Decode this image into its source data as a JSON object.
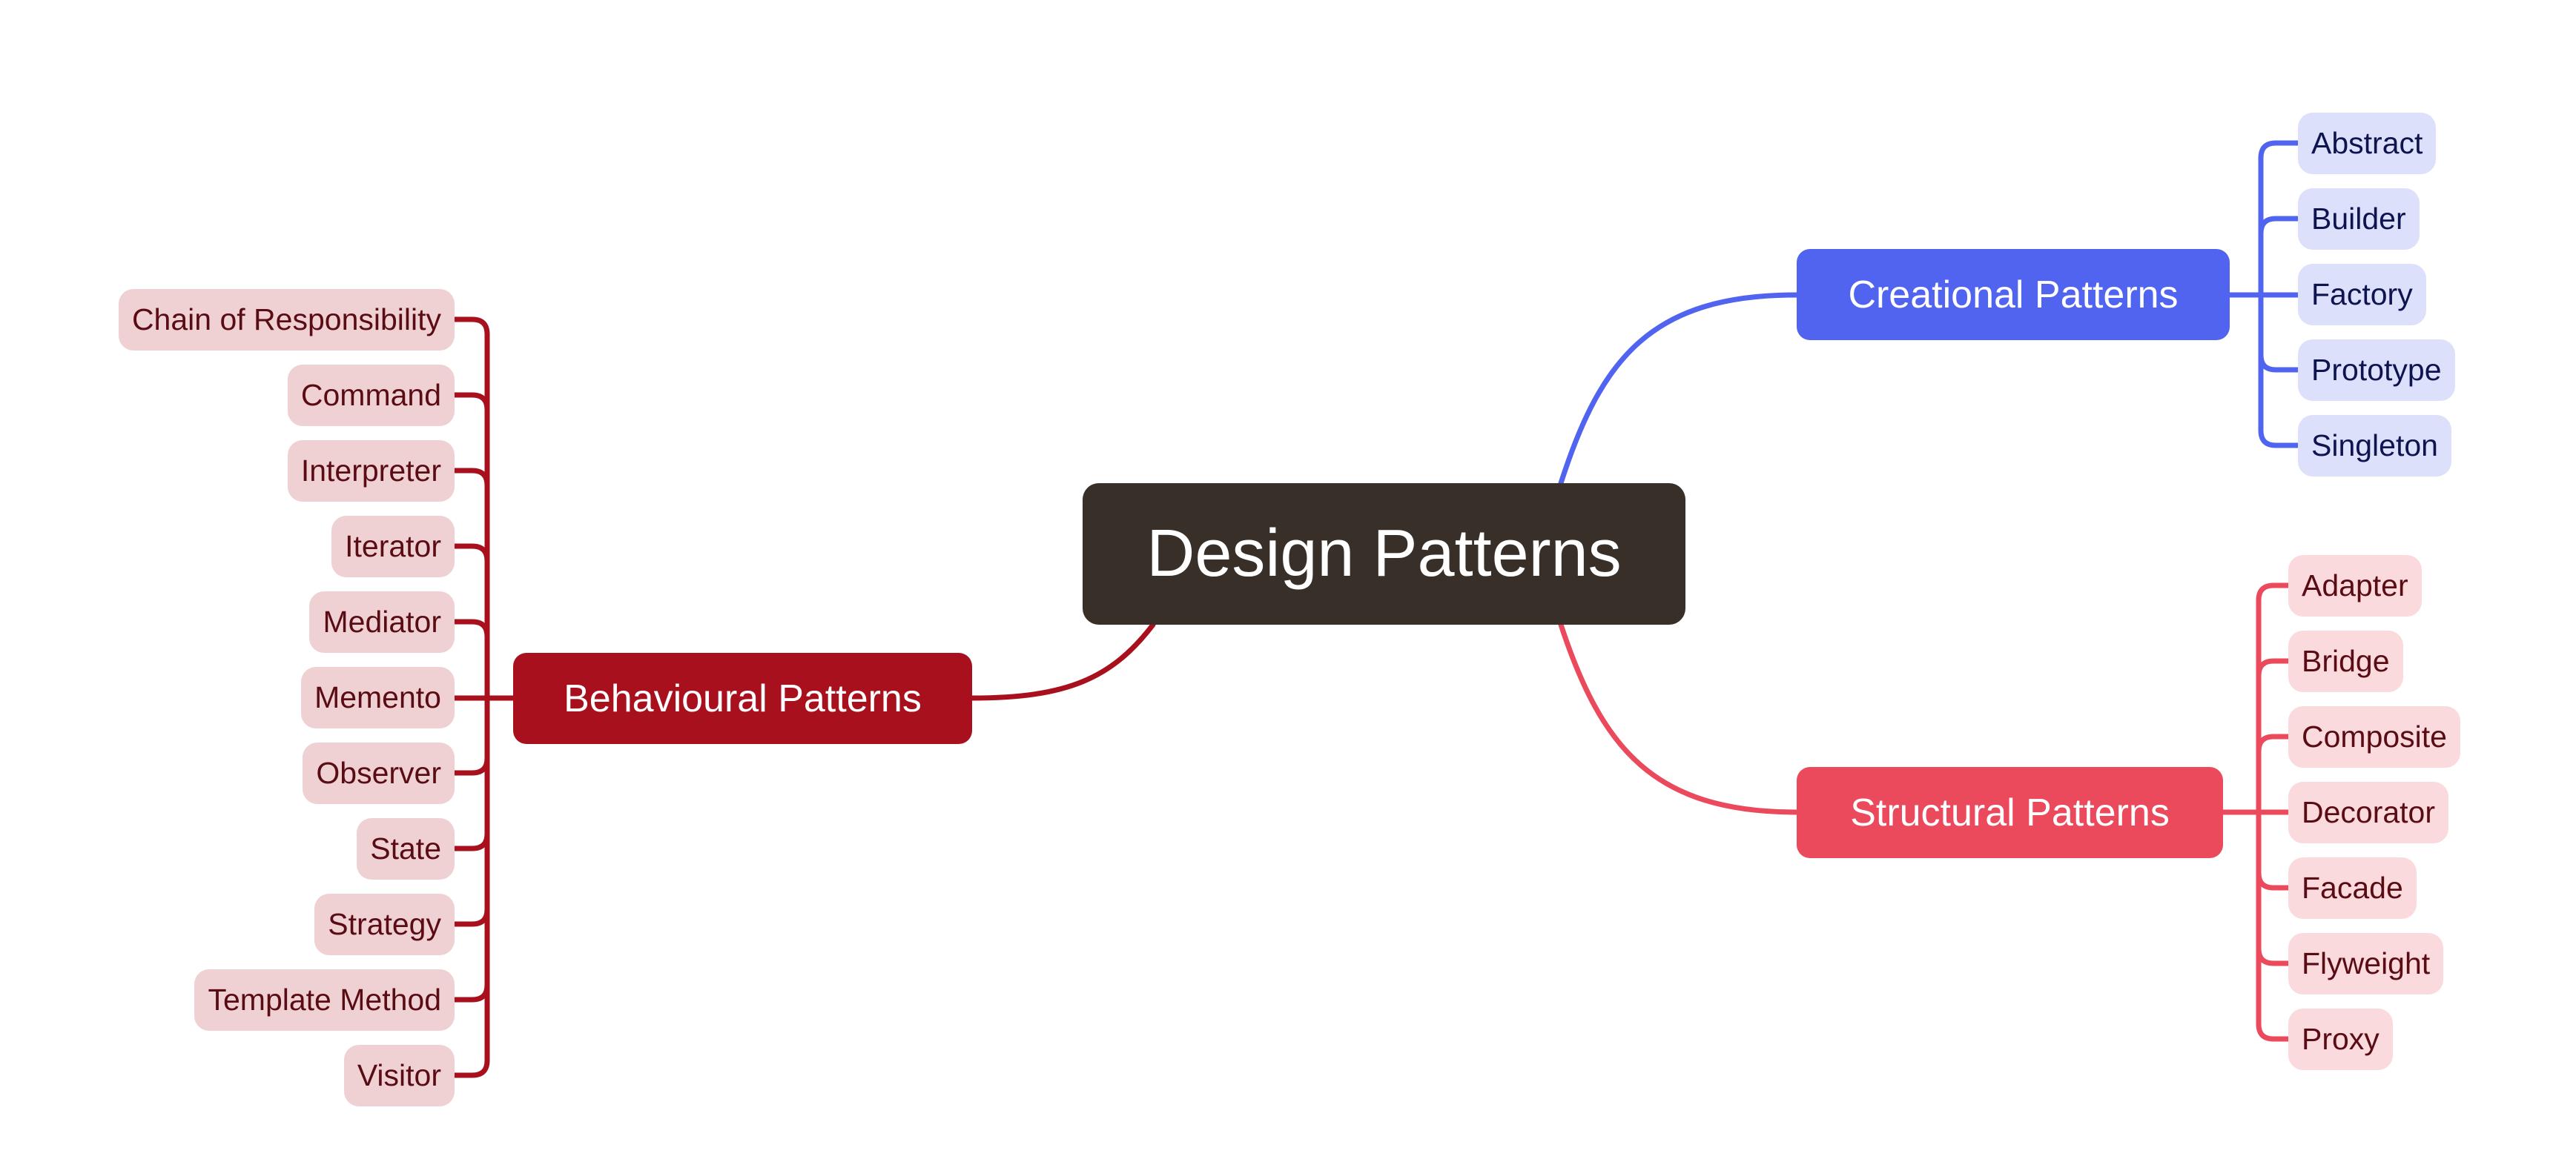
{
  "title": "Design Patterns",
  "colors": {
    "root": "#383028",
    "creational": "#5064F0",
    "structural": "#EB4A5D",
    "behavioural": "#A8101E"
  },
  "branches": {
    "creational": {
      "label": "Creational Patterns",
      "children": [
        "Abstract",
        "Builder",
        "Factory",
        "Prototype",
        "Singleton"
      ]
    },
    "structural": {
      "label": "Structural Patterns",
      "children": [
        "Adapter",
        "Bridge",
        "Composite",
        "Decorator",
        "Facade",
        "Flyweight",
        "Proxy"
      ]
    },
    "behavioural": {
      "label": "Behavioural Patterns",
      "children": [
        "Chain of Responsibility",
        "Command",
        "Interpreter",
        "Iterator",
        "Mediator",
        "Memento",
        "Observer",
        "State",
        "Strategy",
        "Template Method",
        "Visitor"
      ]
    }
  }
}
